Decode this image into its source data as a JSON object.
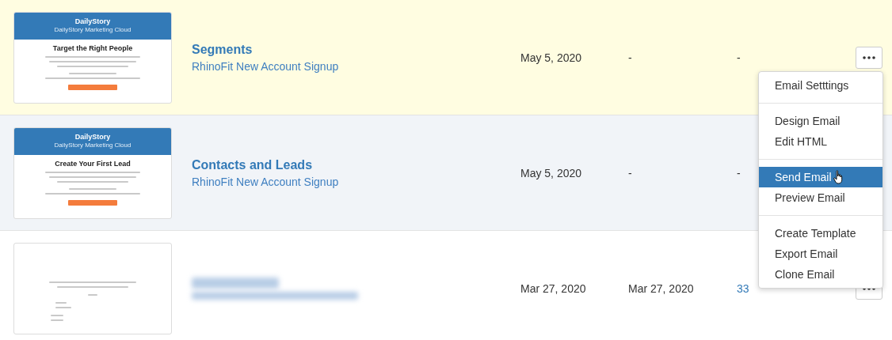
{
  "rows": [
    {
      "selected": true,
      "hovered": false,
      "thumbnail": {
        "kind": "branded",
        "brand": "DailyStory",
        "tagline": "DailyStory Marketing Cloud",
        "headline": "Target the Right People"
      },
      "name": "Segments",
      "list": "RhinoFit New Account Signup",
      "date_1": "May 5, 2020",
      "date_2": "-",
      "column_5": "-",
      "column_5_link": false,
      "menu_button": true
    },
    {
      "selected": false,
      "hovered": true,
      "thumbnail": {
        "kind": "branded",
        "brand": "DailyStory",
        "tagline": "DailyStory Marketing Cloud",
        "headline": "Create Your First Lead"
      },
      "name": "Contacts and Leads",
      "list": "RhinoFit New Account Signup",
      "date_1": "May 5, 2020",
      "date_2": "-",
      "column_5": "-",
      "column_5_link": false,
      "menu_button": false
    },
    {
      "selected": false,
      "hovered": false,
      "thumbnail": {
        "kind": "plain"
      },
      "name_blurred": true,
      "date_1": "Mar 27, 2020",
      "date_2": "Mar 27, 2020",
      "column_5": "33",
      "column_5_link": true,
      "menu_button": true
    }
  ],
  "menu": {
    "groups": [
      [
        {
          "label": "Email Setttings",
          "selected": false
        }
      ],
      [
        {
          "label": "Design Email",
          "selected": false
        },
        {
          "label": "Edit HTML",
          "selected": false
        }
      ],
      [
        {
          "label": "Send Email",
          "selected": true
        },
        {
          "label": "Preview Email",
          "selected": false
        }
      ],
      [
        {
          "label": "Create Template",
          "selected": false
        },
        {
          "label": "Export Email",
          "selected": false
        },
        {
          "label": "Clone Email",
          "selected": false
        }
      ]
    ]
  }
}
